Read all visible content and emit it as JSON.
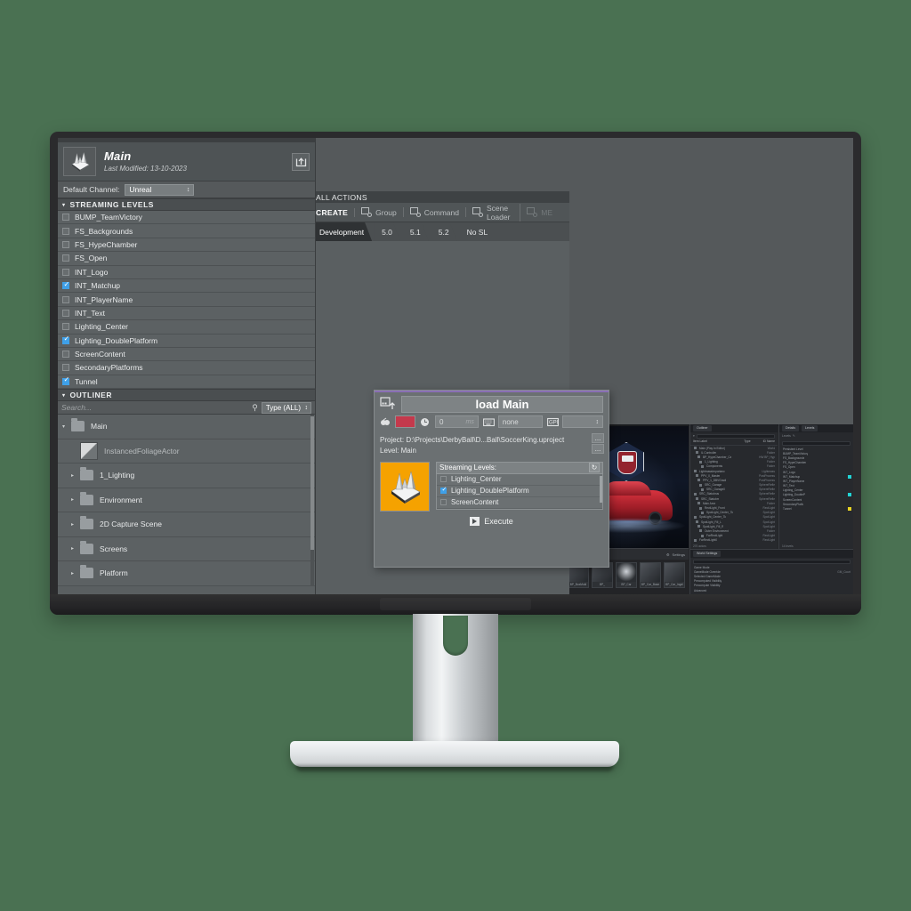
{
  "background": {
    "color": "#4a7152"
  },
  "monitor": {
    "bezel_color": "#2b2b2d",
    "screen_bg": "#55595b"
  },
  "left_panel": {
    "header": {
      "title": "Main",
      "subtitle": "Last Modified: 13-10-2023",
      "thumbnail_icon": "level-thumbnail-icon",
      "export_icon": "export-upload-icon"
    },
    "default_channel": {
      "label": "Default Channel:",
      "value": "Unreal"
    },
    "streaming_levels": {
      "section_label": "STREAMING LEVELS",
      "caret": "▾",
      "items": [
        {
          "name": "BUMP_TeamVictory",
          "checked": false
        },
        {
          "name": "FS_Backgrounds",
          "checked": false
        },
        {
          "name": "FS_HypeChamber",
          "checked": false
        },
        {
          "name": "FS_Open",
          "checked": false
        },
        {
          "name": "INT_Logo",
          "checked": false
        },
        {
          "name": "INT_Matchup",
          "checked": true
        },
        {
          "name": "INT_PlayerName",
          "checked": false
        },
        {
          "name": "INT_Text",
          "checked": false
        },
        {
          "name": "Lighting_Center",
          "checked": false
        },
        {
          "name": "Lighting_DoublePlatform",
          "checked": true
        },
        {
          "name": "ScreenContent",
          "checked": false
        },
        {
          "name": "SecondaryPlatforms",
          "checked": false
        },
        {
          "name": "Tunnel",
          "checked": true
        }
      ]
    },
    "outliner": {
      "section_label": "OUTLINER",
      "caret": "▾",
      "search_placeholder": "Search...",
      "search_icon": "search-icon",
      "type_filter": "Type  (ALL)",
      "rows": [
        {
          "label": "Main",
          "kind": "folder",
          "expanded": true,
          "indent": 0
        },
        {
          "label": "InstancedFoliageActor",
          "kind": "actor",
          "expanded": false,
          "indent": 1
        },
        {
          "label": "1_Lighting",
          "kind": "folder",
          "expanded": false,
          "indent": 1
        },
        {
          "label": "Environment",
          "kind": "folder",
          "expanded": false,
          "indent": 1
        },
        {
          "label": "2D Capture Scene",
          "kind": "folder",
          "expanded": false,
          "indent": 1
        },
        {
          "label": "Screens",
          "kind": "folder",
          "expanded": false,
          "indent": 1
        },
        {
          "label": "Platform",
          "kind": "folder",
          "expanded": false,
          "indent": 1
        }
      ]
    }
  },
  "actions_panel": {
    "header": "ALL ACTIONS",
    "toolbar": [
      {
        "label": "CREATE",
        "icon": null,
        "state": "strong"
      },
      {
        "label": "Group",
        "icon": "group-icon",
        "state": "normal"
      },
      {
        "label": "Command",
        "icon": "command-icon",
        "state": "normal"
      },
      {
        "label": "Scene Loader",
        "icon": "scene-loader-icon",
        "state": "normal"
      },
      {
        "label": "ME",
        "icon": "media-icon",
        "state": "faded"
      }
    ],
    "tabs": [
      {
        "label": "Development",
        "active": true
      },
      {
        "label": "5.0",
        "active": false
      },
      {
        "label": "5.1",
        "active": false
      },
      {
        "label": "5.2",
        "active": false
      },
      {
        "label": "No SL",
        "active": false
      }
    ]
  },
  "action_card": {
    "accent_color": "#8a6fb5",
    "icon": "scene-loader-icon",
    "title": "load Main",
    "controls": {
      "transition_icon": "transition-icon",
      "color_swatch": "#c4394c",
      "delay_icon": "clock-icon",
      "delay_value": "0",
      "delay_unit": "ms",
      "keyboard_icon": "keyboard-icon",
      "shortcut_value": "none",
      "gpi_icon": "gpi-icon",
      "gpi_value": ""
    },
    "project_label": "Project:",
    "project_value": "D:\\Projects\\DerbyBall\\D...Ball\\SoccerKing.uproject",
    "level_label": "Level:",
    "level_value": "Main",
    "browse_button": "...",
    "preview_icon": "level-thumbnail-icon",
    "streaming_levels_label": "Streaming Levels:",
    "refresh_icon": "refresh-icon",
    "streaming_levels": [
      {
        "name": "Lighting_Center",
        "checked": false
      },
      {
        "name": "Lighting_DoublePlatform",
        "checked": true
      },
      {
        "name": "ScreenContent",
        "checked": false
      }
    ],
    "execute_label": "Execute",
    "execute_icon": "execute-icon"
  },
  "ue_screenshot": {
    "viewport": {
      "settings_label": "Settings",
      "gear_icon": "gear-icon"
    },
    "thumbnails": [
      {
        "caption": "BP_BoxMold"
      },
      {
        "caption": "BP_"
      },
      {
        "caption": "BP_Car"
      },
      {
        "caption": "BP_Car_Base"
      },
      {
        "caption": "BP_Car_Ingel"
      }
    ],
    "outliner": {
      "tab": "Outliner",
      "search_placeholder": "Search",
      "columns": [
        "Item Label",
        "Type",
        "ID Name"
      ],
      "rows": [
        {
          "label": "Main (Play In Editor)",
          "type": "World"
        },
        {
          "label": "IL Controller",
          "type": "Folder"
        },
        {
          "label": "BP_HypeChamber_Ca",
          "type": "HW BP_Hyp"
        },
        {
          "label": "1_Lighting",
          "type": "Folder"
        },
        {
          "label": "Components",
          "type": "Folder"
        },
        {
          "label": "LightmassImportanc",
          "type": "Lightmass"
        },
        {
          "label": "PPV_0_Master",
          "type": "PostProcess"
        },
        {
          "label": "PPV_1_DBVGradi",
          "type": "PostProcess"
        },
        {
          "label": "SRC_Garage",
          "type": "SphereRefle"
        },
        {
          "label": "SRC_Garage0",
          "type": "SphereRefle"
        },
        {
          "label": "SRC_Statubrus",
          "type": "SphereRefle"
        },
        {
          "label": "SRC_Statubm",
          "type": "SphereRefle"
        },
        {
          "label": "Main Area",
          "type": "Folder"
        },
        {
          "label": "RectLight_Front",
          "type": "RectLight"
        },
        {
          "label": "SpotLight_Center_7k",
          "type": "SpotLight"
        },
        {
          "label": "SpotLight_Center_7k",
          "type": "SpotLight"
        },
        {
          "label": "SpotLight_Fill_L",
          "type": "SpotLight"
        },
        {
          "label": "SpotLight_Fill_R",
          "type": "SpotLight"
        },
        {
          "label": "Outer Environment",
          "type": "Folder"
        },
        {
          "label": "FarRectLight",
          "type": "RectLight"
        },
        {
          "label": "FarRectLight0",
          "type": "RectLight"
        }
      ],
      "footer": "270 actors"
    },
    "details": {
      "tabs": [
        "Details",
        "Levels"
      ],
      "levels_label": "Levels",
      "search_placeholder": "Search Levels",
      "rows": [
        {
          "label": "Persistent Level",
          "chip": null
        },
        {
          "label": "BUMP_TeamVictory",
          "chip": null
        },
        {
          "label": "FS_Backgrounds",
          "chip": null
        },
        {
          "label": "FS_HypeChamber",
          "chip": null
        },
        {
          "label": "FS_Open",
          "chip": null
        },
        {
          "label": "INT_Logo",
          "chip": null
        },
        {
          "label": "INT_Matchup",
          "chip": "#21d4d4"
        },
        {
          "label": "INT_PlayerName",
          "chip": null
        },
        {
          "label": "INT_Text",
          "chip": null
        },
        {
          "label": "Lighting_Center",
          "chip": null
        },
        {
          "label": "Lighting_DoubleP",
          "chip": "#21d4d4"
        },
        {
          "label": "ScreenContent",
          "chip": null
        },
        {
          "label": "SecondaryPlatfo",
          "chip": null
        },
        {
          "label": "Tunnel",
          "chip": "#e8d323"
        }
      ],
      "footer": "14 levels"
    },
    "world_settings": {
      "tab": "World Settings",
      "search_placeholder": "Search",
      "sections": [
        {
          "label": "Game Mode"
        },
        {
          "label": "GameMode Override",
          "value": "GM_Court"
        },
        {
          "label": "Selected GameMode"
        },
        {
          "label": "Precomputed Visibility"
        },
        {
          "label": "Precompute Visibility"
        },
        {
          "label": "Advanced"
        }
      ]
    }
  }
}
